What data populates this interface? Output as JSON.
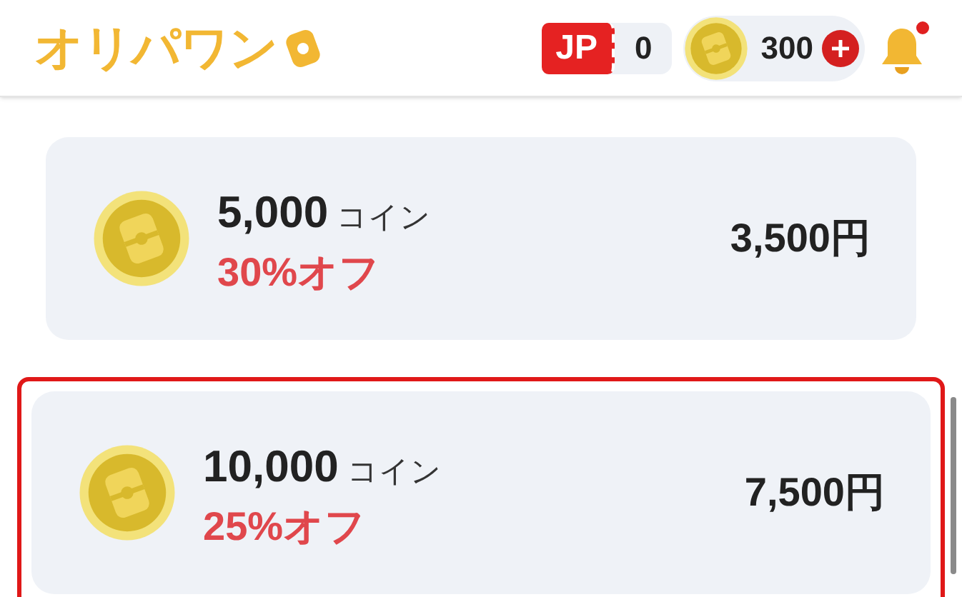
{
  "header": {
    "logo": "オリパワン",
    "ticket_label": "JP",
    "ticket_count": "0",
    "coin_balance": "300",
    "notification": true
  },
  "packages": [
    {
      "coins": "5,000",
      "unit": "コイン",
      "discount": "30%オフ",
      "price": "3,500円",
      "selected": false
    },
    {
      "coins": "10,000",
      "unit": "コイン",
      "discount": "25%オフ",
      "price": "7,500円",
      "selected": true
    }
  ]
}
